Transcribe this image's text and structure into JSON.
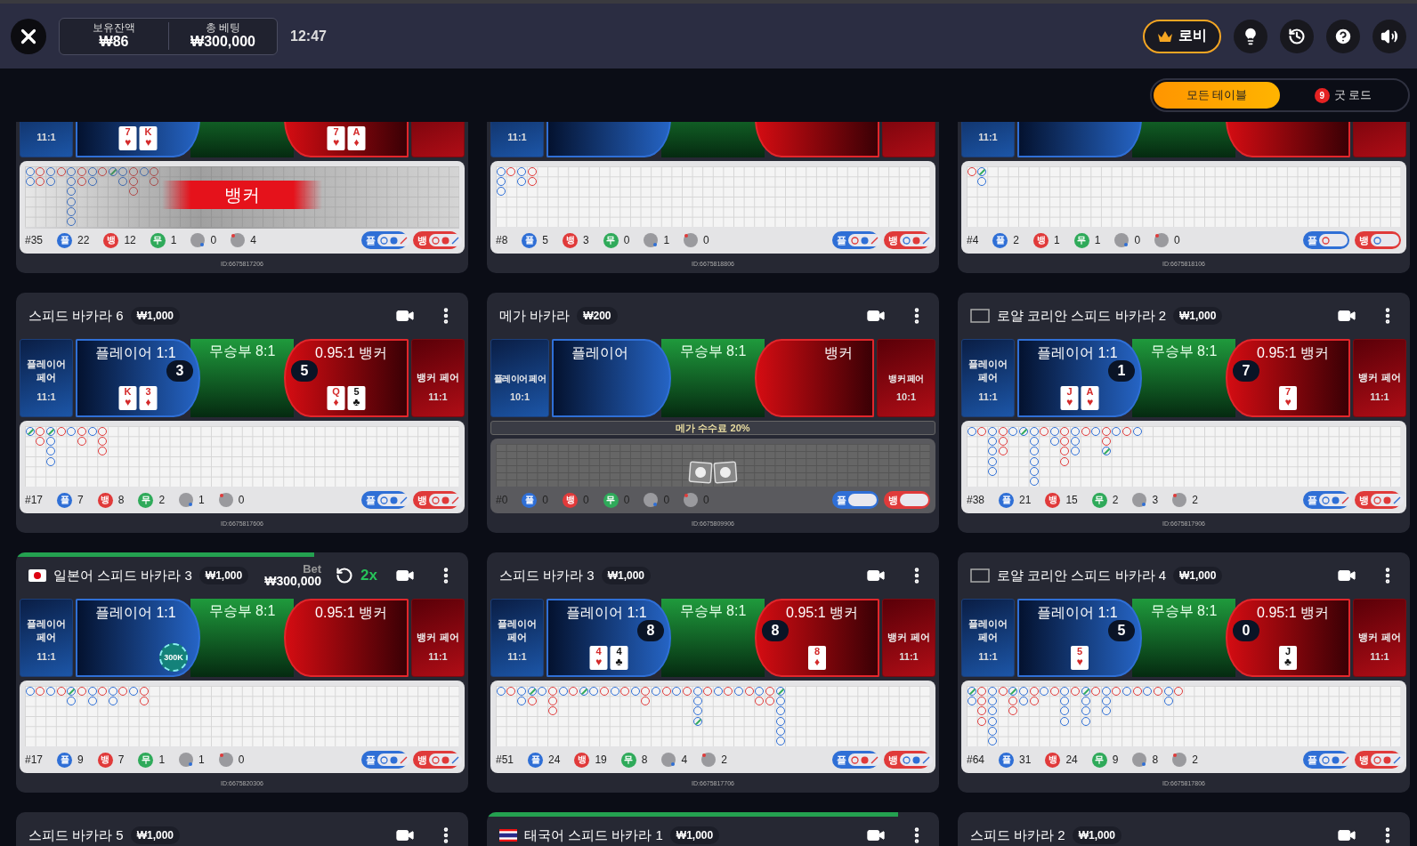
{
  "header": {
    "balance": {
      "label": "보유잔액",
      "value": "₩86"
    },
    "total_bet": {
      "label": "총 베팅",
      "value": "₩300,000"
    },
    "clock": "12:47",
    "lobby": "로비"
  },
  "filters": [
    {
      "label": "모든 테이블",
      "selected": true
    },
    {
      "label": "굿 로드",
      "badge": "9",
      "selected": false
    }
  ],
  "tables": [
    {
      "player_pair": {
        "odds": "11:1"
      },
      "player": {
        "cards": [
          {
            "rank": "7",
            "suit": "♥",
            "color": "#d42a2a"
          },
          {
            "rank": "K",
            "suit": "♥",
            "color": "#d42a2a"
          }
        ]
      },
      "banker": {
        "cards": [
          {
            "rank": "7",
            "suit": "♥",
            "color": "#d42a2a"
          },
          {
            "rank": "A",
            "suit": "♦",
            "color": "#d42a2a"
          }
        ]
      },
      "banner": "뱅커",
      "road": [
        [
          {
            "kind": "p"
          },
          {
            "kind": "p"
          }
        ],
        [
          {
            "kind": "b"
          },
          {
            "kind": "b"
          }
        ],
        [
          {
            "kind": "p"
          },
          {
            "kind": "p"
          }
        ],
        [
          {
            "kind": "b"
          }
        ],
        [
          {
            "kind": "p"
          },
          {
            "kind": "p"
          },
          {
            "kind": "p"
          },
          {
            "kind": "p"
          },
          {
            "kind": "p"
          },
          {
            "kind": "p"
          }
        ],
        [
          {
            "kind": "b"
          },
          {
            "kind": "b"
          }
        ],
        [
          {
            "kind": "p"
          },
          {
            "kind": "p"
          }
        ],
        [
          {
            "kind": "b"
          }
        ],
        [
          {
            "kind": "t"
          }
        ],
        [
          {
            "kind": "p"
          },
          {
            "kind": "p"
          }
        ],
        [
          {
            "kind": "b"
          },
          {
            "kind": "b"
          },
          {
            "kind": "b"
          }
        ],
        [
          {
            "kind": "p"
          }
        ],
        [
          {
            "kind": "b"
          },
          {
            "kind": "b"
          }
        ]
      ],
      "stats": {
        "round": "#35",
        "player": {
          "letter": "플",
          "count": "22"
        },
        "banker": {
          "letter": "뱅",
          "count": "12"
        },
        "tie": {
          "letter": "무",
          "count": "1"
        },
        "player_pair": "0",
        "banker_pair": "4"
      },
      "predictors": [
        {
          "letter": "플",
          "marks": [
            {
              "color": "#2f6fd6"
            },
            {
              "color": "#2f6fd6"
            },
            {
              "color": "#e03a3a"
            }
          ]
        },
        {
          "letter": "뱅",
          "marks": [
            {
              "color": "#e03a3a"
            },
            {
              "color": "#e03a3a"
            },
            {
              "color": "#2f6fd6"
            }
          ]
        }
      ],
      "id": "ID:6675817206"
    },
    {
      "player_pair": {
        "odds": "11:1"
      },
      "road": [
        [
          {
            "kind": "p"
          },
          {
            "kind": "p"
          },
          {
            "kind": "p"
          }
        ],
        [
          {
            "kind": "b"
          }
        ],
        [
          {
            "kind": "p"
          },
          {
            "kind": "p"
          }
        ],
        [
          {
            "kind": "b"
          },
          {
            "kind": "b"
          }
        ]
      ],
      "stats": {
        "round": "#8",
        "player": {
          "letter": "플",
          "count": "5"
        },
        "banker": {
          "letter": "뱅",
          "count": "3"
        },
        "tie": {
          "letter": "무",
          "count": "0"
        },
        "player_pair": "1",
        "banker_pair": "0"
      },
      "predictors": [
        {
          "letter": "플",
          "marks": [
            {
              "color": "#e03a3a"
            },
            {
              "color": "#2f6fd6"
            },
            {
              "color": "#e03a3a"
            }
          ]
        },
        {
          "letter": "뱅",
          "marks": [
            {
              "color": "#2f6fd6"
            },
            {
              "color": "#e03a3a"
            },
            {
              "color": "#2f6fd6"
            }
          ]
        }
      ],
      "id": "ID:6675818806"
    },
    {
      "player_pair": {
        "odds": "11:1"
      },
      "road": [
        [
          {
            "kind": "b"
          }
        ],
        [
          {
            "kind": "t"
          },
          {
            "kind": "p"
          }
        ]
      ],
      "stats": {
        "round": "#4",
        "player": {
          "letter": "플",
          "count": "2"
        },
        "banker": {
          "letter": "뱅",
          "count": "1"
        },
        "tie": {
          "letter": "무",
          "count": "1"
        },
        "player_pair": "0",
        "banker_pair": "0"
      },
      "predictors": [
        {
          "letter": "플",
          "marks": [
            {
              "color": "#e03a3a"
            }
          ]
        },
        {
          "letter": "뱅",
          "marks": [
            {
              "color": "#2f6fd6"
            }
          ]
        }
      ],
      "id": "ID:6675818106"
    },
    {
      "name": "스피드 바카라 6",
      "limit": "₩1,000",
      "player_pair": {
        "label": "플레이어 페어",
        "odds": "11:1"
      },
      "player": {
        "label": "플레이어 1:1",
        "score": "3",
        "cards": [
          {
            "rank": "K",
            "suit": "♥",
            "color": "#d42a2a"
          },
          {
            "rank": "3",
            "suit": "♦",
            "color": "#d42a2a"
          }
        ]
      },
      "tie": {
        "label": "무승부 8:1"
      },
      "banker": {
        "label": "0.95:1 뱅커",
        "score": "5",
        "cards": [
          {
            "rank": "Q",
            "suit": "♦",
            "color": "#d42a2a"
          },
          {
            "rank": "5",
            "suit": "♣",
            "color": "#111111"
          }
        ]
      },
      "banker_pair": {
        "label": "뱅커 페어",
        "odds": "11:1"
      },
      "road": [
        [
          {
            "kind": "t"
          }
        ],
        [
          {
            "kind": "b"
          },
          {
            "kind": "b"
          }
        ],
        [
          {
            "kind": "t"
          },
          {
            "kind": "p"
          },
          {
            "kind": "p"
          },
          {
            "kind": "p"
          }
        ],
        [
          {
            "kind": "b"
          }
        ],
        [
          {
            "kind": "p"
          }
        ],
        [
          {
            "kind": "b"
          },
          {
            "kind": "b"
          }
        ],
        [
          {
            "kind": "p"
          }
        ],
        [
          {
            "kind": "b"
          },
          {
            "kind": "b"
          },
          {
            "kind": "b"
          }
        ]
      ],
      "stats": {
        "round": "#17",
        "player": {
          "letter": "플",
          "count": "7"
        },
        "banker": {
          "letter": "뱅",
          "count": "8"
        },
        "tie": {
          "letter": "무",
          "count": "2"
        },
        "player_pair": "1",
        "banker_pair": "0"
      },
      "predictors": [
        {
          "letter": "플",
          "marks": [
            {
              "color": "#2f6fd6"
            },
            {
              "color": "#2f6fd6"
            },
            {
              "color": "#2f6fd6"
            }
          ]
        },
        {
          "letter": "뱅",
          "marks": [
            {
              "color": "#e03a3a"
            },
            {
              "color": "#e03a3a"
            },
            {
              "color": "#e03a3a"
            }
          ]
        }
      ],
      "id": "ID:6675817606"
    },
    {
      "name": "메가 바카라",
      "limit": "₩200",
      "player_pair": {
        "label": "플레이어 페어",
        "odds": "10:1"
      },
      "player": {
        "label": "플레이어"
      },
      "tie": {
        "label": "무승부 8:1"
      },
      "banker": {
        "label": "뱅커"
      },
      "banker_pair": {
        "label": "뱅커 페어",
        "odds": "10:1"
      },
      "mega": "메가 수수료 20%",
      "disabled": true,
      "stats": {
        "round": "#0",
        "player": {
          "letter": "플",
          "count": "0"
        },
        "banker": {
          "letter": "뱅",
          "count": "0"
        },
        "tie": {
          "letter": "무",
          "count": "0"
        },
        "player_pair": "0",
        "banker_pair": "0"
      },
      "predictors": [
        {
          "letter": "플"
        },
        {
          "letter": "뱅"
        }
      ],
      "id": "ID:6675809906"
    },
    {
      "name": "로얄 코리안 스피드 바카라 2",
      "limit": "₩1,000",
      "flag": {
        "kind": "blank"
      },
      "player_pair": {
        "label": "플레이어 페어",
        "odds": "11:1"
      },
      "player": {
        "label": "플레이어 1:1",
        "score": "1",
        "cards": [
          {
            "rank": "J",
            "suit": "♥",
            "color": "#d42a2a"
          },
          {
            "rank": "A",
            "suit": "♥",
            "color": "#d42a2a"
          }
        ]
      },
      "tie": {
        "label": "무승부 8:1"
      },
      "banker": {
        "label": "0.95:1 뱅커",
        "score": "7",
        "cards": [
          {
            "rank": "7",
            "suit": "♥",
            "color": "#d42a2a"
          }
        ]
      },
      "banker_pair": {
        "label": "뱅커 페어",
        "odds": "11:1"
      },
      "road": [
        [
          {
            "kind": "p"
          }
        ],
        [
          {
            "kind": "b"
          }
        ],
        [
          {
            "kind": "p"
          },
          {
            "kind": "p"
          },
          {
            "kind": "p"
          },
          {
            "kind": "p"
          },
          {
            "kind": "p"
          }
        ],
        [
          {
            "kind": "b"
          },
          {
            "kind": "b"
          },
          {
            "kind": "b"
          }
        ],
        [
          {
            "kind": "p"
          }
        ],
        [
          {
            "kind": "t"
          }
        ],
        [
          {
            "kind": "p"
          },
          {
            "kind": "p"
          },
          {
            "kind": "p"
          },
          {
            "kind": "p"
          },
          {
            "kind": "p"
          },
          {
            "kind": "p"
          }
        ],
        [
          {
            "kind": "b"
          }
        ],
        [
          {
            "kind": "p"
          },
          {
            "kind": "p"
          }
        ],
        [
          {
            "kind": "b"
          },
          {
            "kind": "b"
          },
          {
            "kind": "b"
          },
          {
            "kind": "b"
          }
        ],
        [
          {
            "kind": "p"
          },
          {
            "kind": "p"
          },
          {
            "kind": "p"
          }
        ],
        [
          {
            "kind": "b"
          }
        ],
        [
          {
            "kind": "p"
          }
        ],
        [
          {
            "kind": "b"
          },
          {
            "kind": "b"
          },
          {
            "kind": "t"
          }
        ],
        [
          {
            "kind": "p"
          }
        ],
        [
          {
            "kind": "b"
          }
        ],
        [
          {
            "kind": "p"
          }
        ]
      ],
      "stats": {
        "round": "#38",
        "player": {
          "letter": "플",
          "count": "21"
        },
        "banker": {
          "letter": "뱅",
          "count": "15"
        },
        "tie": {
          "letter": "무",
          "count": "2"
        },
        "player_pair": "3",
        "banker_pair": "2"
      },
      "predictors": [
        {
          "letter": "플",
          "marks": [
            {
              "color": "#2f6fd6"
            },
            {
              "color": "#2f6fd6"
            },
            {
              "color": "#e03a3a"
            }
          ]
        },
        {
          "letter": "뱅",
          "marks": [
            {
              "color": "#e03a3a"
            },
            {
              "color": "#e03a3a"
            },
            {
              "color": "#2f6fd6"
            }
          ]
        }
      ],
      "id": "ID:6675817906"
    },
    {
      "name": "일본어 스피드 바카라 3",
      "limit": "₩1,000",
      "flag": {
        "kind": "japan"
      },
      "progress": {
        "level": 0.66
      },
      "bet": {
        "label": "Bet",
        "amount": "₩300,000"
      },
      "multiplier": "2x",
      "player_pair": {
        "label": "플레이어 페어",
        "odds": "11:1"
      },
      "player": {
        "label": "플레이어 1:1",
        "chip": "300K"
      },
      "tie": {
        "label": "무승부 8:1"
      },
      "banker": {
        "label": "0.95:1 뱅커"
      },
      "banker_pair": {
        "label": "뱅커 페어",
        "odds": "11:1"
      },
      "road": [
        [
          {
            "kind": "p"
          }
        ],
        [
          {
            "kind": "b"
          }
        ],
        [
          {
            "kind": "p"
          }
        ],
        [
          {
            "kind": "b"
          }
        ],
        [
          {
            "kind": "t"
          },
          {
            "kind": "p"
          }
        ],
        [
          {
            "kind": "b"
          }
        ],
        [
          {
            "kind": "p"
          },
          {
            "kind": "p"
          }
        ],
        [
          {
            "kind": "b"
          }
        ],
        [
          {
            "kind": "p"
          },
          {
            "kind": "p"
          }
        ],
        [
          {
            "kind": "b"
          }
        ],
        [
          {
            "kind": "p"
          }
        ],
        [
          {
            "kind": "b"
          },
          {
            "kind": "b"
          }
        ]
      ],
      "stats": {
        "round": "#17",
        "player": {
          "letter": "플",
          "count": "9"
        },
        "banker": {
          "letter": "뱅",
          "count": "7"
        },
        "tie": {
          "letter": "무",
          "count": "1"
        },
        "player_pair": "1",
        "banker_pair": "0"
      },
      "predictors": [
        {
          "letter": "플",
          "marks": [
            {
              "color": "#2f6fd6"
            },
            {
              "color": "#2f6fd6"
            },
            {
              "color": "#e03a3a"
            }
          ]
        },
        {
          "letter": "뱅",
          "marks": [
            {
              "color": "#e03a3a"
            },
            {
              "color": "#e03a3a"
            },
            {
              "color": "#2f6fd6"
            }
          ]
        }
      ],
      "id": "ID:6675820306"
    },
    {
      "name": "스피드 바카라 3",
      "limit": "₩1,000",
      "player_pair": {
        "label": "플레이어 페어",
        "odds": "11:1"
      },
      "player": {
        "label": "플레이어 1:1",
        "score": "8",
        "cards": [
          {
            "rank": "4",
            "suit": "♥",
            "color": "#d42a2a"
          },
          {
            "rank": "4",
            "suit": "♣",
            "color": "#111111"
          }
        ]
      },
      "tie": {
        "label": "무승부 8:1"
      },
      "banker": {
        "label": "0.95:1 뱅커",
        "score": "8",
        "cards": [
          {
            "rank": "8",
            "suit": "♦",
            "color": "#d42a2a"
          }
        ]
      },
      "banker_pair": {
        "label": "뱅커 페어",
        "odds": "11:1"
      },
      "road": [
        [
          {
            "kind": "p"
          }
        ],
        [
          {
            "kind": "b"
          }
        ],
        [
          {
            "kind": "p"
          },
          {
            "kind": "p"
          }
        ],
        [
          {
            "kind": "t"
          },
          {
            "kind": "b"
          }
        ],
        [
          {
            "kind": "p"
          }
        ],
        [
          {
            "kind": "b"
          },
          {
            "kind": "b"
          },
          {
            "kind": "b"
          }
        ],
        [
          {
            "kind": "p"
          }
        ],
        [
          {
            "kind": "b"
          }
        ],
        [
          {
            "kind": "t"
          }
        ],
        [
          {
            "kind": "p"
          }
        ],
        [
          {
            "kind": "b"
          }
        ],
        [
          {
            "kind": "p"
          }
        ],
        [
          {
            "kind": "b"
          }
        ],
        [
          {
            "kind": "p"
          }
        ],
        [
          {
            "kind": "b"
          },
          {
            "kind": "b"
          }
        ],
        [
          {
            "kind": "p"
          }
        ],
        [
          {
            "kind": "b"
          }
        ],
        [
          {
            "kind": "p"
          }
        ],
        [
          {
            "kind": "b"
          }
        ],
        [
          {
            "kind": "p"
          },
          {
            "kind": "p"
          },
          {
            "kind": "p"
          },
          {
            "kind": "t"
          }
        ],
        [
          {
            "kind": "b"
          }
        ],
        [
          {
            "kind": "p"
          }
        ],
        [
          {
            "kind": "b"
          }
        ],
        [
          {
            "kind": "p"
          }
        ],
        [
          {
            "kind": "b"
          }
        ],
        [
          {
            "kind": "p"
          },
          {
            "kind": "b"
          }
        ],
        [
          {
            "kind": "b"
          },
          {
            "kind": "b"
          }
        ],
        [
          {
            "kind": "t"
          },
          {
            "kind": "p"
          },
          {
            "kind": "p"
          },
          {
            "kind": "p"
          },
          {
            "kind": "p"
          },
          {
            "kind": "p"
          }
        ]
      ],
      "stats": {
        "round": "#51",
        "player": {
          "letter": "플",
          "count": "24"
        },
        "banker": {
          "letter": "뱅",
          "count": "19"
        },
        "tie": {
          "letter": "무",
          "count": "8"
        },
        "player_pair": "4",
        "banker_pair": "2"
      },
      "predictors": [
        {
          "letter": "플",
          "marks": [
            {
              "color": "#e03a3a"
            },
            {
              "color": "#e03a3a"
            },
            {
              "color": "#e03a3a"
            }
          ]
        },
        {
          "letter": "뱅",
          "marks": [
            {
              "color": "#2f6fd6"
            },
            {
              "color": "#2f6fd6"
            },
            {
              "color": "#2f6fd6"
            }
          ]
        }
      ],
      "id": "ID:6675817706"
    },
    {
      "name": "로얄 코리안 스피드 바카라 4",
      "limit": "₩1,000",
      "flag": {
        "kind": "blank"
      },
      "player_pair": {
        "label": "플레이어 페어",
        "odds": "11:1"
      },
      "player": {
        "label": "플레이어 1:1",
        "score": "5",
        "cards": [
          {
            "rank": "5",
            "suit": "♥",
            "color": "#d42a2a"
          }
        ]
      },
      "tie": {
        "label": "무승부 8:1"
      },
      "banker": {
        "label": "0.95:1 뱅커",
        "score": "0",
        "cards": [
          {
            "rank": "J",
            "suit": "♣",
            "color": "#111111"
          }
        ]
      },
      "banker_pair": {
        "label": "뱅커 페어",
        "odds": "11:1"
      },
      "road": [
        [
          {
            "kind": "t"
          },
          {
            "kind": "p"
          }
        ],
        [
          {
            "kind": "b"
          },
          {
            "kind": "b"
          },
          {
            "kind": "b"
          },
          {
            "kind": "b"
          }
        ],
        [
          {
            "kind": "p"
          },
          {
            "kind": "p"
          },
          {
            "kind": "p"
          },
          {
            "kind": "p"
          },
          {
            "kind": "p"
          },
          {
            "kind": "p"
          }
        ],
        [
          {
            "kind": "b"
          }
        ],
        [
          {
            "kind": "t"
          },
          {
            "kind": "b"
          },
          {
            "kind": "b"
          }
        ],
        [
          {
            "kind": "p"
          },
          {
            "kind": "p"
          }
        ],
        [
          {
            "kind": "b"
          },
          {
            "kind": "b"
          }
        ],
        [
          {
            "kind": "p"
          }
        ],
        [
          {
            "kind": "b"
          }
        ],
        [
          {
            "kind": "p"
          },
          {
            "kind": "p"
          },
          {
            "kind": "p"
          },
          {
            "kind": "p"
          }
        ],
        [
          {
            "kind": "b"
          }
        ],
        [
          {
            "kind": "t"
          },
          {
            "kind": "p"
          },
          {
            "kind": "p"
          },
          {
            "kind": "p"
          }
        ],
        [
          {
            "kind": "b"
          }
        ],
        [
          {
            "kind": "p"
          },
          {
            "kind": "p"
          },
          {
            "kind": "p"
          }
        ],
        [
          {
            "kind": "b"
          }
        ],
        [
          {
            "kind": "p"
          }
        ],
        [
          {
            "kind": "b"
          }
        ],
        [
          {
            "kind": "p"
          }
        ],
        [
          {
            "kind": "b"
          }
        ],
        [
          {
            "kind": "p"
          },
          {
            "kind": "p"
          }
        ],
        [
          {
            "kind": "b"
          }
        ]
      ],
      "stats": {
        "round": "#64",
        "player": {
          "letter": "플",
          "count": "31"
        },
        "banker": {
          "letter": "뱅",
          "count": "24"
        },
        "tie": {
          "letter": "무",
          "count": "9"
        },
        "player_pair": "8",
        "banker_pair": "2"
      },
      "predictors": [
        {
          "letter": "플",
          "marks": [
            {
              "color": "#2f6fd6"
            },
            {
              "color": "#2f6fd6"
            },
            {
              "color": "#e03a3a"
            }
          ]
        },
        {
          "letter": "뱅",
          "marks": [
            {
              "color": "#e03a3a"
            },
            {
              "color": "#e03a3a"
            },
            {
              "color": "#2f6fd6"
            }
          ]
        }
      ],
      "id": "ID:6675817806"
    },
    {
      "name": "스피드 바카라 5",
      "limit": "₩1,000"
    },
    {
      "name": "태국어 스피드 바카라 1",
      "limit": "₩1,000",
      "flag": {
        "kind": "thailand"
      },
      "progress": {
        "level": 0.91
      }
    },
    {
      "name": "스피드 바카라 2",
      "limit": "₩1,000"
    }
  ]
}
